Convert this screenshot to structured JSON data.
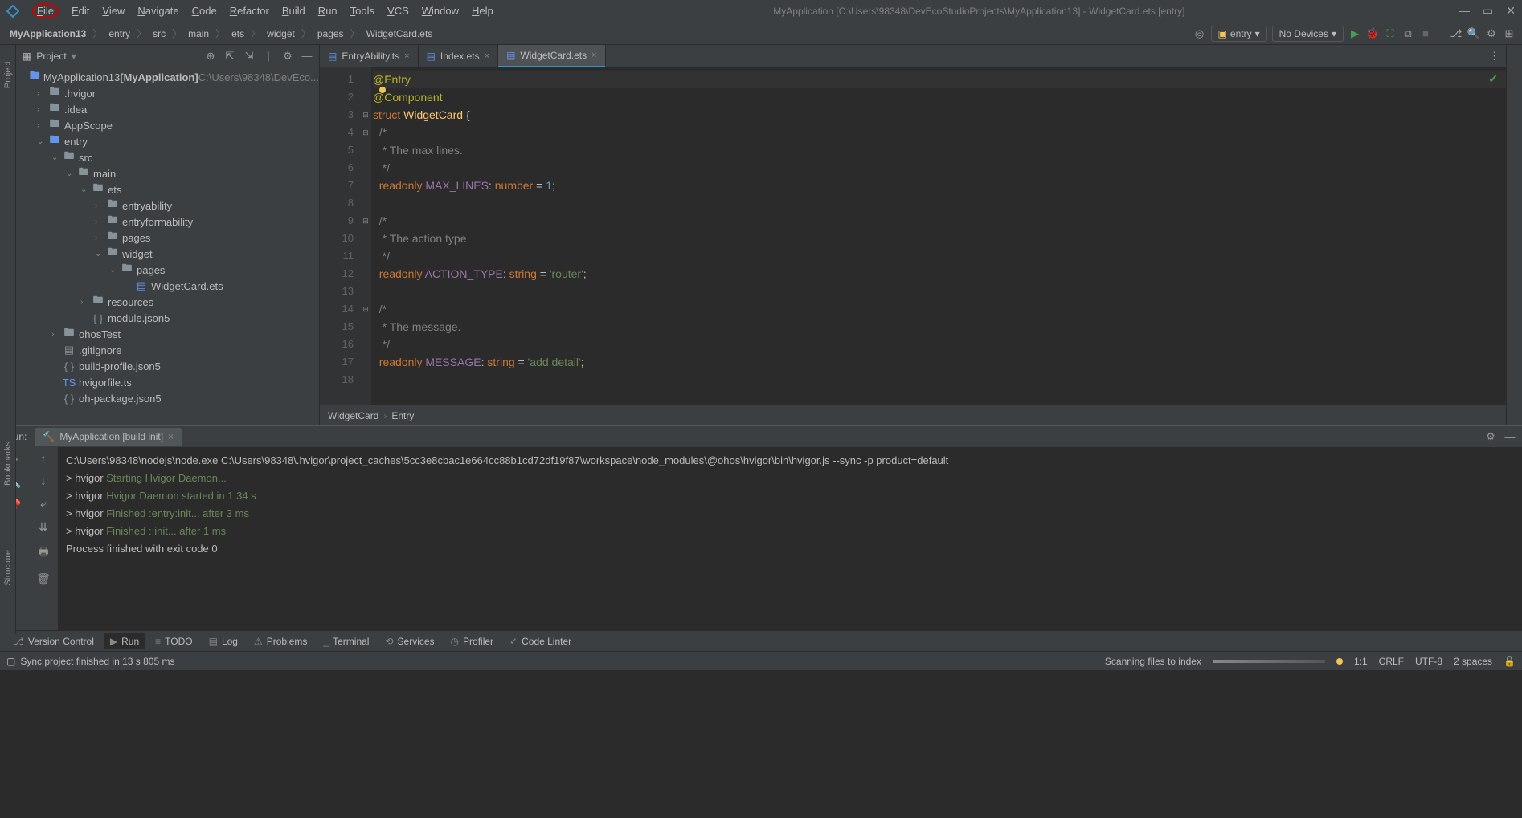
{
  "titlebar": {
    "menus": [
      "File",
      "Edit",
      "View",
      "Navigate",
      "Code",
      "Refactor",
      "Build",
      "Run",
      "Tools",
      "VCS",
      "Window",
      "Help"
    ],
    "title": "MyApplication [C:\\Users\\98348\\DevEcoStudioProjects\\MyApplication13] - WidgetCard.ets [entry]"
  },
  "breadcrumb": [
    "MyApplication13",
    "entry",
    "src",
    "main",
    "ets",
    "widget",
    "pages",
    "WidgetCard.ets"
  ],
  "toolbar": {
    "config": "entry",
    "device": "No Devices"
  },
  "project_panel": {
    "title": "Project",
    "tree": [
      {
        "indent": 0,
        "arrow": "",
        "icon": "proj",
        "label": "MyApplication13",
        "suffix_bold": " [MyApplication]",
        "suffix_dim": "  C:\\Users\\98348\\DevEco..."
      },
      {
        "indent": 1,
        "arrow": "›",
        "icon": "folder",
        "label": ".hvigor"
      },
      {
        "indent": 1,
        "arrow": "›",
        "icon": "folder",
        "label": ".idea"
      },
      {
        "indent": 1,
        "arrow": "›",
        "icon": "folder",
        "label": "AppScope"
      },
      {
        "indent": 1,
        "arrow": "⌄",
        "icon": "folder-entry",
        "label": "entry"
      },
      {
        "indent": 2,
        "arrow": "⌄",
        "icon": "folder",
        "label": "src"
      },
      {
        "indent": 3,
        "arrow": "⌄",
        "icon": "folder",
        "label": "main"
      },
      {
        "indent": 4,
        "arrow": "⌄",
        "icon": "folder",
        "label": "ets"
      },
      {
        "indent": 5,
        "arrow": "›",
        "icon": "folder",
        "label": "entryability"
      },
      {
        "indent": 5,
        "arrow": "›",
        "icon": "folder",
        "label": "entryformability"
      },
      {
        "indent": 5,
        "arrow": "›",
        "icon": "folder",
        "label": "pages"
      },
      {
        "indent": 5,
        "arrow": "⌄",
        "icon": "folder",
        "label": "widget"
      },
      {
        "indent": 6,
        "arrow": "⌄",
        "icon": "folder",
        "label": "pages"
      },
      {
        "indent": 7,
        "arrow": "",
        "icon": "ets-file",
        "label": "WidgetCard.ets"
      },
      {
        "indent": 4,
        "arrow": "›",
        "icon": "folder",
        "label": "resources"
      },
      {
        "indent": 4,
        "arrow": "",
        "icon": "json-file",
        "label": "module.json5"
      },
      {
        "indent": 2,
        "arrow": "›",
        "icon": "folder",
        "label": "ohosTest"
      },
      {
        "indent": 2,
        "arrow": "",
        "icon": "file",
        "label": ".gitignore"
      },
      {
        "indent": 2,
        "arrow": "",
        "icon": "json-file",
        "label": "build-profile.json5"
      },
      {
        "indent": 2,
        "arrow": "",
        "icon": "ts-file",
        "label": "hvigorfile.ts"
      },
      {
        "indent": 2,
        "arrow": "",
        "icon": "json-file",
        "label": "oh-package.json5"
      }
    ]
  },
  "side_tabs": {
    "left_top": "Project",
    "left_bottom1": "Bookmarks",
    "left_bottom2": "Structure"
  },
  "editor": {
    "tabs": [
      {
        "label": "EntryAbility.ts",
        "active": false
      },
      {
        "label": "Index.ets",
        "active": false
      },
      {
        "label": "WidgetCard.ets",
        "active": true
      }
    ],
    "lines": [
      {
        "n": 1,
        "html": "<span class='c-anno'>@Entry</span>",
        "cursor": true
      },
      {
        "n": 2,
        "html": "<span class='c-anno'>@Component</span>"
      },
      {
        "n": 3,
        "html": "<span class='c-kw'>struct</span> <span class='c-struct'>WidgetCard</span> {",
        "fold": "⊟"
      },
      {
        "n": 4,
        "html": "  <span class='c-com'>/*</span>",
        "fold": "⊟"
      },
      {
        "n": 5,
        "html": "  <span class='c-com'> * The max lines.</span>"
      },
      {
        "n": 6,
        "html": "  <span class='c-com'> */</span>"
      },
      {
        "n": 7,
        "html": "  <span class='c-kw'>readonly</span> <span class='c-ident'>MAX_LINES</span>: <span class='c-kw'>number</span> = <span class='c-num'>1</span>;"
      },
      {
        "n": 8,
        "html": ""
      },
      {
        "n": 9,
        "html": "  <span class='c-com'>/*</span>",
        "fold": "⊟"
      },
      {
        "n": 10,
        "html": "  <span class='c-com'> * The action type.</span>"
      },
      {
        "n": 11,
        "html": "  <span class='c-com'> */</span>"
      },
      {
        "n": 12,
        "html": "  <span class='c-kw'>readonly</span> <span class='c-ident'>ACTION_TYPE</span>: <span class='c-kw'>string</span> = <span class='c-str'>'router'</span>;"
      },
      {
        "n": 13,
        "html": ""
      },
      {
        "n": 14,
        "html": "  <span class='c-com'>/*</span>",
        "fold": "⊟"
      },
      {
        "n": 15,
        "html": "  <span class='c-com'> * The message.</span>"
      },
      {
        "n": 16,
        "html": "  <span class='c-com'> */</span>"
      },
      {
        "n": 17,
        "html": "  <span class='c-kw'>readonly</span> <span class='c-ident'>MESSAGE</span>: <span class='c-kw'>string</span> = <span class='c-str'>'add detail'</span>;"
      },
      {
        "n": 18,
        "html": ""
      }
    ],
    "crumbs": [
      "WidgetCard",
      "Entry"
    ]
  },
  "run": {
    "label": "Run:",
    "tab": "MyApplication [build init]",
    "console": [
      {
        "pre": "",
        "green": "",
        "text": "C:\\Users\\98348\\nodejs\\node.exe C:\\Users\\98348\\.hvigor\\project_caches\\5cc3e8cbac1e664cc88b1cd72df19f87\\workspace\\node_modules\\@ohos\\hvigor\\bin\\hvigor.js --sync -p product=default"
      },
      {
        "pre": "> hvigor ",
        "green": "Starting Hvigor Daemon...",
        "text": ""
      },
      {
        "pre": "> hvigor ",
        "green": "Hvigor Daemon started in 1.34 s",
        "text": ""
      },
      {
        "pre": "> hvigor ",
        "green": "Finished :entry:init... after 3 ms",
        "text": ""
      },
      {
        "pre": "> hvigor ",
        "green": "Finished ::init... after 1 ms",
        "text": ""
      },
      {
        "pre": "",
        "green": "",
        "text": ""
      },
      {
        "pre": "",
        "green": "",
        "text": "Process finished with exit code 0"
      }
    ]
  },
  "bottom_tabs": [
    {
      "icon": "branch",
      "label": "Version Control"
    },
    {
      "icon": "play",
      "label": "Run",
      "active": true
    },
    {
      "icon": "todo",
      "label": "TODO"
    },
    {
      "icon": "log",
      "label": "Log"
    },
    {
      "icon": "warn",
      "label": "Problems"
    },
    {
      "icon": "term",
      "label": "Terminal"
    },
    {
      "icon": "svc",
      "label": "Services"
    },
    {
      "icon": "prof",
      "label": "Profiler"
    },
    {
      "icon": "lint",
      "label": "Code Linter"
    }
  ],
  "statusbar": {
    "left": "Sync project finished in 13 s 805 ms",
    "scanning": "Scanning files to index",
    "pos": "1:1",
    "eol": "CRLF",
    "enc": "UTF-8",
    "indent": "2 spaces"
  }
}
